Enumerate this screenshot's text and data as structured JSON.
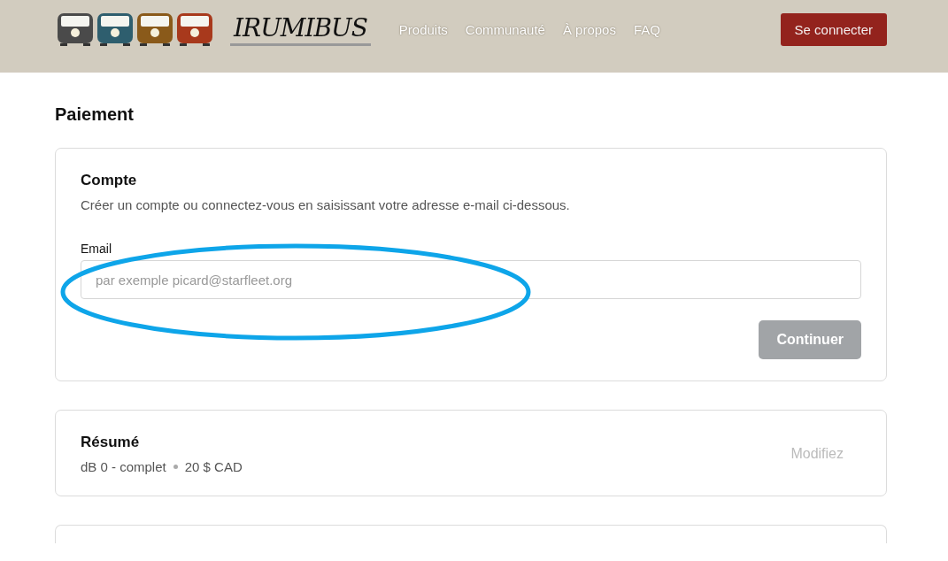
{
  "header": {
    "logo": "IRUMIBUS",
    "nav": [
      "Produits",
      "Communauté",
      "À propos",
      "FAQ"
    ],
    "login_button": "Se connecter"
  },
  "page_title": "Paiement",
  "account": {
    "title": "Compte",
    "description": "Créer un compte ou connectez-vous en saisissant votre adresse e-mail ci-dessous.",
    "email_label": "Email",
    "email_placeholder": "par exemple picard@starfleet.org",
    "continue_button": {
      "label": "Continuer",
      "disabled": true
    }
  },
  "summary": {
    "title": "Résumé",
    "item": "dB 0 - complet",
    "price": "20 $ CAD",
    "edit_link": "Modifiez"
  }
}
